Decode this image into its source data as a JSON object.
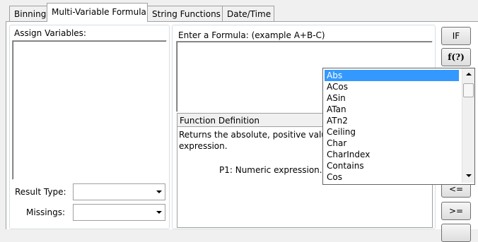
{
  "tabs": [
    "Binning",
    "Multi-Variable Formula",
    "String Functions",
    "Date/Time"
  ],
  "assign_variables_label": "Assign Variables:",
  "result_type_label": "Result Type:",
  "missings_label": "Missings:",
  "formula_label": "Enter a Formula: (example A+B-C)",
  "function_definition_label": "Function Definition",
  "function_definition_text_1": "Returns the absolute, positive value",
  "function_definition_text_2": "expression.",
  "function_param_text": "P1: Numeric expression.",
  "buttons": {
    "if": "IF",
    "f": "f(?)",
    "le": "<=",
    "ge": ">="
  },
  "function_list": [
    "Abs",
    "ACos",
    "ASin",
    "ATan",
    "ATn2",
    "Ceiling",
    "Char",
    "CharIndex",
    "Contains",
    "Cos"
  ],
  "selected_function": "Abs"
}
